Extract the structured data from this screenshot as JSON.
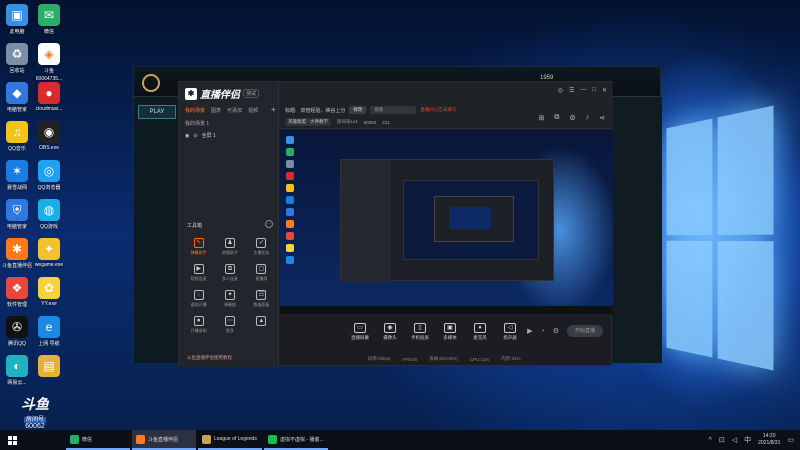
{
  "desktop": {
    "icons": [
      {
        "label": "此电脑",
        "icon": "computer-icon",
        "color": "#3b8fe0"
      },
      {
        "label": "微信",
        "icon": "wechat-icon",
        "color": "#2aae67"
      },
      {
        "label": "回收站",
        "icon": "recycle-bin-icon",
        "color": "#7b8ea8"
      },
      {
        "label": "斗鱼",
        "sublabel": "60064735...",
        "icon": "douyu-icon",
        "color": "#ffffff"
      },
      {
        "label": "电脑管家",
        "icon": "pc-manager-icon",
        "color": "#2f78e0"
      },
      {
        "label": "cloudmusi...",
        "icon": "cloudmusic-icon",
        "color": "#d82c2c"
      },
      {
        "label": "QQ音乐",
        "icon": "qqmusic-icon",
        "color": "#f2c318"
      },
      {
        "label": "OBS.exe",
        "icon": "obs-icon",
        "color": "#222222"
      },
      {
        "label": "暴雪战网",
        "icon": "battlenet-icon",
        "color": "#1a7de0"
      },
      {
        "label": "QQ浏览器",
        "icon": "qqbrowser-icon",
        "color": "#1fa1f0"
      },
      {
        "label": "电脑管家",
        "icon": "shield-icon",
        "color": "#2f78e0"
      },
      {
        "label": "QQ游戏",
        "icon": "qqgame-icon",
        "color": "#19b0e8"
      },
      {
        "label": "斗鱼直播伴侣",
        "icon": "douyu-companion-icon",
        "color": "#ff7a1a"
      },
      {
        "label": "wegame.exe",
        "icon": "wegame-icon",
        "color": "#f3c12c"
      },
      {
        "label": "软件管理",
        "icon": "software-manager-icon",
        "color": "#e8483c"
      },
      {
        "label": "YY.exe",
        "icon": "yy-icon",
        "color": "#f7d23a"
      },
      {
        "label": "腾讯QQ",
        "icon": "qq-icon",
        "color": "#111111"
      },
      {
        "label": "上网 导航",
        "icon": "ie-icon",
        "color": "#1e88e5"
      },
      {
        "label": "网易云...",
        "icon": "netease-icon",
        "color": "#1db3c2"
      },
      {
        "label": "",
        "icon": "folder-icon",
        "color": "#e3b23c"
      }
    ],
    "watermark": {
      "brand": "斗鱼",
      "room_label": "房间号",
      "room_no": "60062"
    }
  },
  "game": {
    "play_label": "PLAY",
    "stats": [
      "1959",
      "",
      ""
    ],
    "left_tab": "排位赛"
  },
  "stream": {
    "brand": "直播伴侣",
    "version": "测试",
    "left_tabs": [
      "我的场景",
      "图表",
      "可添加",
      "视频"
    ],
    "scene": "我的场景 1",
    "layer": "全屏 1",
    "tools_title": "工具箱",
    "tools": [
      {
        "label": "弹幕助手",
        "icon": "danmaku-icon",
        "highlight": true
      },
      {
        "label": "房管助手",
        "icon": "user-icon",
        "highlight": false
      },
      {
        "label": "主播任务",
        "icon": "task-icon",
        "highlight": false
      },
      {
        "label": "视频连麦",
        "icon": "video-link-icon",
        "highlight": false
      },
      {
        "label": "多人连麦",
        "icon": "multi-link-icon",
        "highlight": false
      },
      {
        "label": "直播屏",
        "icon": "screen-icon",
        "highlight": false
      },
      {
        "label": "虚拟开播",
        "icon": "virtual-icon",
        "highlight": false
      },
      {
        "label": "弹幕姬",
        "icon": "danmaku-display-icon",
        "highlight": false
      },
      {
        "label": "数据面板",
        "icon": "data-panel-icon",
        "highlight": false
      },
      {
        "label": "开播录制",
        "icon": "record-icon",
        "highlight": false
      },
      {
        "label": "更多",
        "icon": "more-icon",
        "highlight": false
      },
      {
        "label": "",
        "icon": "triangle-icon",
        "highlight": false
      }
    ],
    "left_bottom": "斗鱼直播伴侣使用教程",
    "title_label": "标题:",
    "title_value": "双倍经验，峡谷上分",
    "edit_label": "修改",
    "search_placeholder": "搜索",
    "notice": "直播间公告未填写",
    "category": "英雄联盟 · 大神教学",
    "room_info": "房间号Lv1",
    "room_id": "60062",
    "viewers": "211",
    "controls": [
      {
        "label": "直播屏幕",
        "icon": "screen-share-icon"
      },
      {
        "label": "摄像头",
        "icon": "camera-icon"
      },
      {
        "label": "手机投屏",
        "icon": "phone-cast-icon"
      },
      {
        "label": "多媒体",
        "icon": "media-icon"
      },
      {
        "label": "麦克风",
        "icon": "microphone-icon"
      },
      {
        "label": "扬声器",
        "icon": "speaker-icon"
      }
    ],
    "start_label": "开始直播",
    "status": [
      "码率:0kbps",
      "FPS:60",
      "丢帧:0(0.00%)",
      "CPU:11%",
      "内存:31%"
    ]
  },
  "taskbar": {
    "apps": [
      {
        "label": "微信",
        "icon": "wechat-icon",
        "color": "#2aae67",
        "active": false
      },
      {
        "label": "斗鱼直播伴侣",
        "icon": "douyu-companion-icon",
        "color": "#ff7a1a",
        "active": true
      },
      {
        "label": "League of Legends",
        "icon": "lol-icon",
        "color": "#c8a45a",
        "active": false
      },
      {
        "label": "虚拟不虚拟 - 播客...",
        "icon": "browser-icon",
        "color": "#1db954",
        "active": false
      }
    ],
    "time": "14:20",
    "date": "2021/8/31"
  }
}
